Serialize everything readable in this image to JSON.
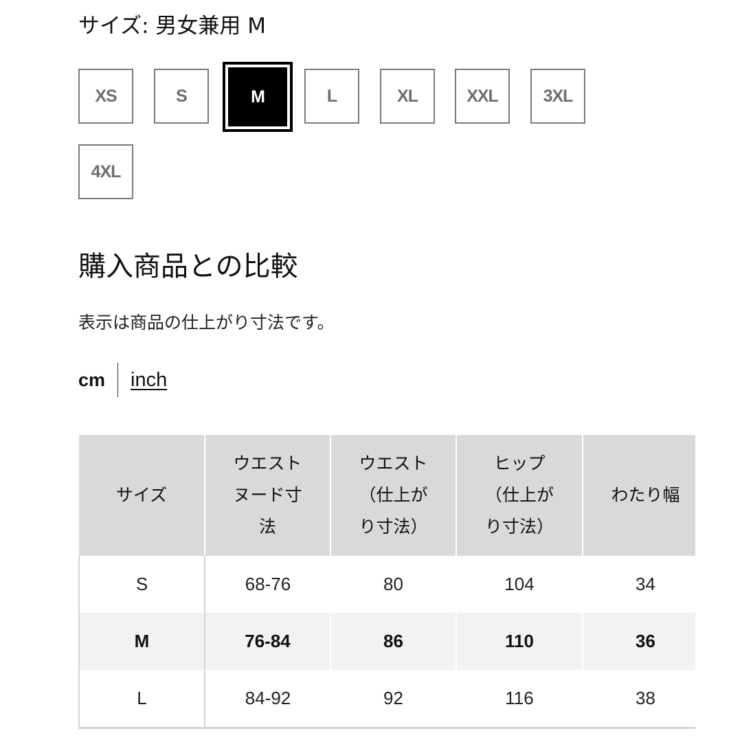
{
  "header": {
    "size_label": "サイズ: 男女兼用 M"
  },
  "sizes": {
    "selected": "M",
    "options": [
      "XS",
      "S",
      "M",
      "L",
      "XL",
      "XXL",
      "3XL",
      "4XL"
    ]
  },
  "comparison": {
    "heading": "購入商品との比較",
    "note": "表示は商品の仕上がり寸法です。",
    "units": {
      "active": "cm",
      "other": "inch"
    }
  },
  "table": {
    "columns": [
      "サイズ",
      "ウエスト ヌード寸法",
      "ウエスト （仕上がり寸法）",
      "ヒップ （仕上がり寸法）",
      "わたり幅"
    ],
    "column_lines": [
      [
        "サイズ"
      ],
      [
        "ウエスト",
        "ヌード寸",
        "法"
      ],
      [
        "ウエスト",
        "（仕上が",
        "り寸法）"
      ],
      [
        "ヒップ",
        "（仕上が",
        "り寸法）"
      ],
      [
        "わたり幅"
      ]
    ],
    "rows": [
      {
        "size": "S",
        "waist_nude": "68-76",
        "waist_finished": "80",
        "hip": "104",
        "thigh": "34",
        "selected": false
      },
      {
        "size": "M",
        "waist_nude": "76-84",
        "waist_finished": "86",
        "hip": "110",
        "thigh": "36",
        "selected": true
      },
      {
        "size": "L",
        "waist_nude": "84-92",
        "waist_finished": "92",
        "hip": "116",
        "thigh": "38",
        "selected": false
      }
    ]
  }
}
